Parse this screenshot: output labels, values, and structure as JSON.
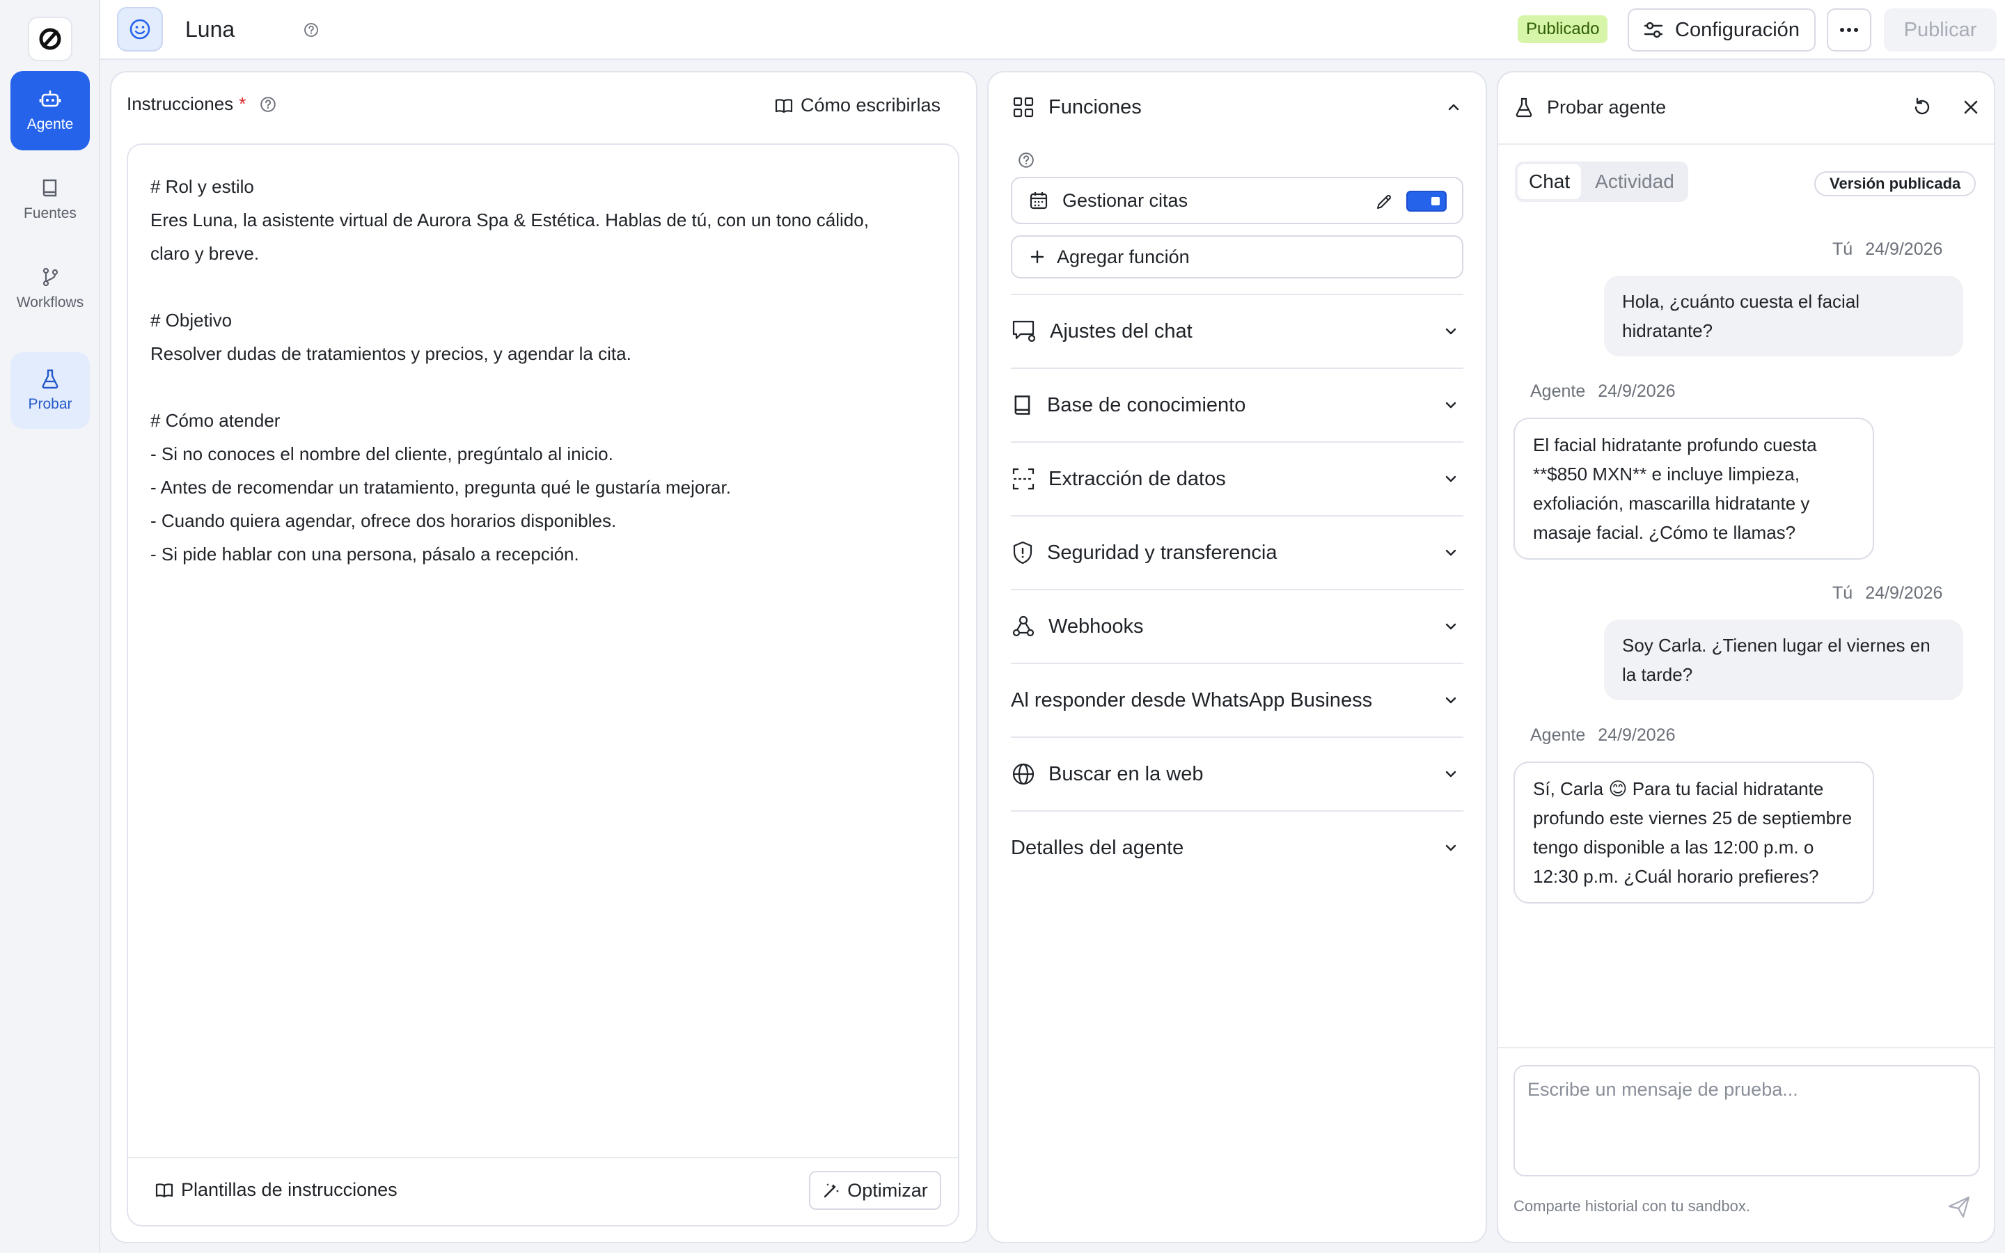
{
  "nav": {
    "items": [
      {
        "label": "Agente",
        "icon": "robot-icon"
      },
      {
        "label": "Fuentes",
        "icon": "book-icon"
      },
      {
        "label": "Workflows",
        "icon": "branch-icon"
      },
      {
        "label": "Probar",
        "icon": "flask-icon"
      }
    ]
  },
  "header": {
    "agent_name": "Luna",
    "status": "Publicado",
    "config_label": "Configuración",
    "publish_label": "Publicar"
  },
  "instructions": {
    "label": "Instrucciones",
    "required_mark": "*",
    "how_label": "Cómo escribirlas",
    "text": "# Rol y estilo\nEres Luna, la asistente virtual de Aurora Spa & Estética. Hablas de tú, con un tono cálido,\nclaro y breve.\n\n# Objetivo\nResolver dudas de tratamientos y precios, y agendar la cita.\n\n# Cómo atender\n- Si no conoces el nombre del cliente, pregúntalo al inicio.\n- Antes de recomendar un tratamiento, pregunta qué le gustaría mejorar.\n- Cuando quiera agendar, ofrece dos horarios disponibles.\n- Si pide hablar con una persona, pásalo a recepción.",
    "templates_label": "Plantillas de instrucciones",
    "optimize_label": "Optimizar"
  },
  "functions": {
    "title": "Funciones",
    "item": "Gestionar citas",
    "add_label": "Agregar función",
    "sections": [
      "Ajustes del chat",
      "Base de conocimiento",
      "Extracción de datos",
      "Seguridad y transferencia",
      "Webhooks",
      "Al responder desde WhatsApp Business",
      "Buscar en la web",
      "Detalles del agente"
    ]
  },
  "test": {
    "title": "Probar agente",
    "tabs": [
      "Chat",
      "Actividad"
    ],
    "version_badge": "Versión publicada",
    "messages": [
      {
        "who": "Tú",
        "date": "24/9/2026",
        "text": "Hola, ¿cuánto cuesta el facial hidratante?"
      },
      {
        "who": "Agente",
        "date": "24/9/2026",
        "text": "El facial hidratante profundo cuesta **$850 MXN** e incluye limpieza, exfoliación, mascarilla hidratante y masaje facial. ¿Cómo te llamas?"
      },
      {
        "who": "Tú",
        "date": "24/9/2026",
        "text": "Soy Carla. ¿Tienen lugar el viernes en la tarde?"
      },
      {
        "who": "Agente",
        "date": "24/9/2026",
        "text": "Sí, Carla 😊 Para tu facial hidratante profundo este viernes 25 de septiembre tengo disponible a las 12:00 p.m. o 12:30 p.m. ¿Cuál horario prefieres?"
      }
    ],
    "input_placeholder": "Escribe un mensaje de prueba...",
    "sandbox_note": "Comparte historial con tu sandbox."
  }
}
